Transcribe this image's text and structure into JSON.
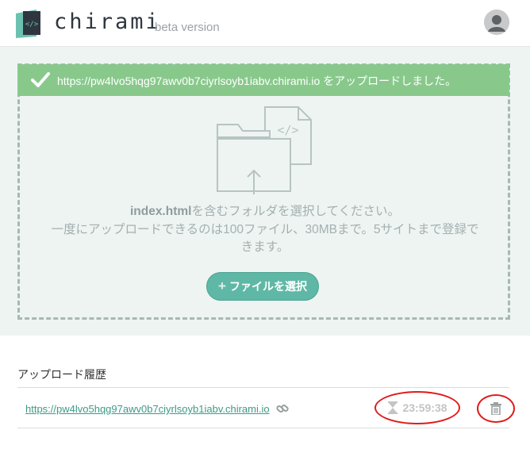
{
  "brand": {
    "name": "chirami",
    "subtitle": "beta version"
  },
  "header": {
    "avatar_icon": "user-avatar-icon"
  },
  "notice": {
    "icon": "check-icon",
    "message": "https://pw4lvo5hqg97awv0b7ciyrlsoyb1iabv.chirami.io をアップロードしました。"
  },
  "upload": {
    "illustration_icon": "folder-upload-icon",
    "instruction_bold": "index.html",
    "instruction_rest": "を含むフォルダを選択してください。",
    "limits_line1": "一度にアップロードできるのは100ファイル、30MBまで。5サイトまで登録で",
    "limits_line2": "きます。",
    "button_plus": "+",
    "button_label": "ファイルを選択"
  },
  "history": {
    "title": "アップロード履歴",
    "items": [
      {
        "url": "https://pw4lvo5hqg97awv0b7ciyrlsoyb1iabv.chirami.io",
        "link_icon": "link-icon",
        "timer_icon": "hourglass-icon",
        "remaining": "23:59:38",
        "delete_icon": "trash-icon"
      }
    ]
  },
  "colors": {
    "accent": "#5fb8a6",
    "success": "#88c98b",
    "highlight": "#e01b1b"
  }
}
